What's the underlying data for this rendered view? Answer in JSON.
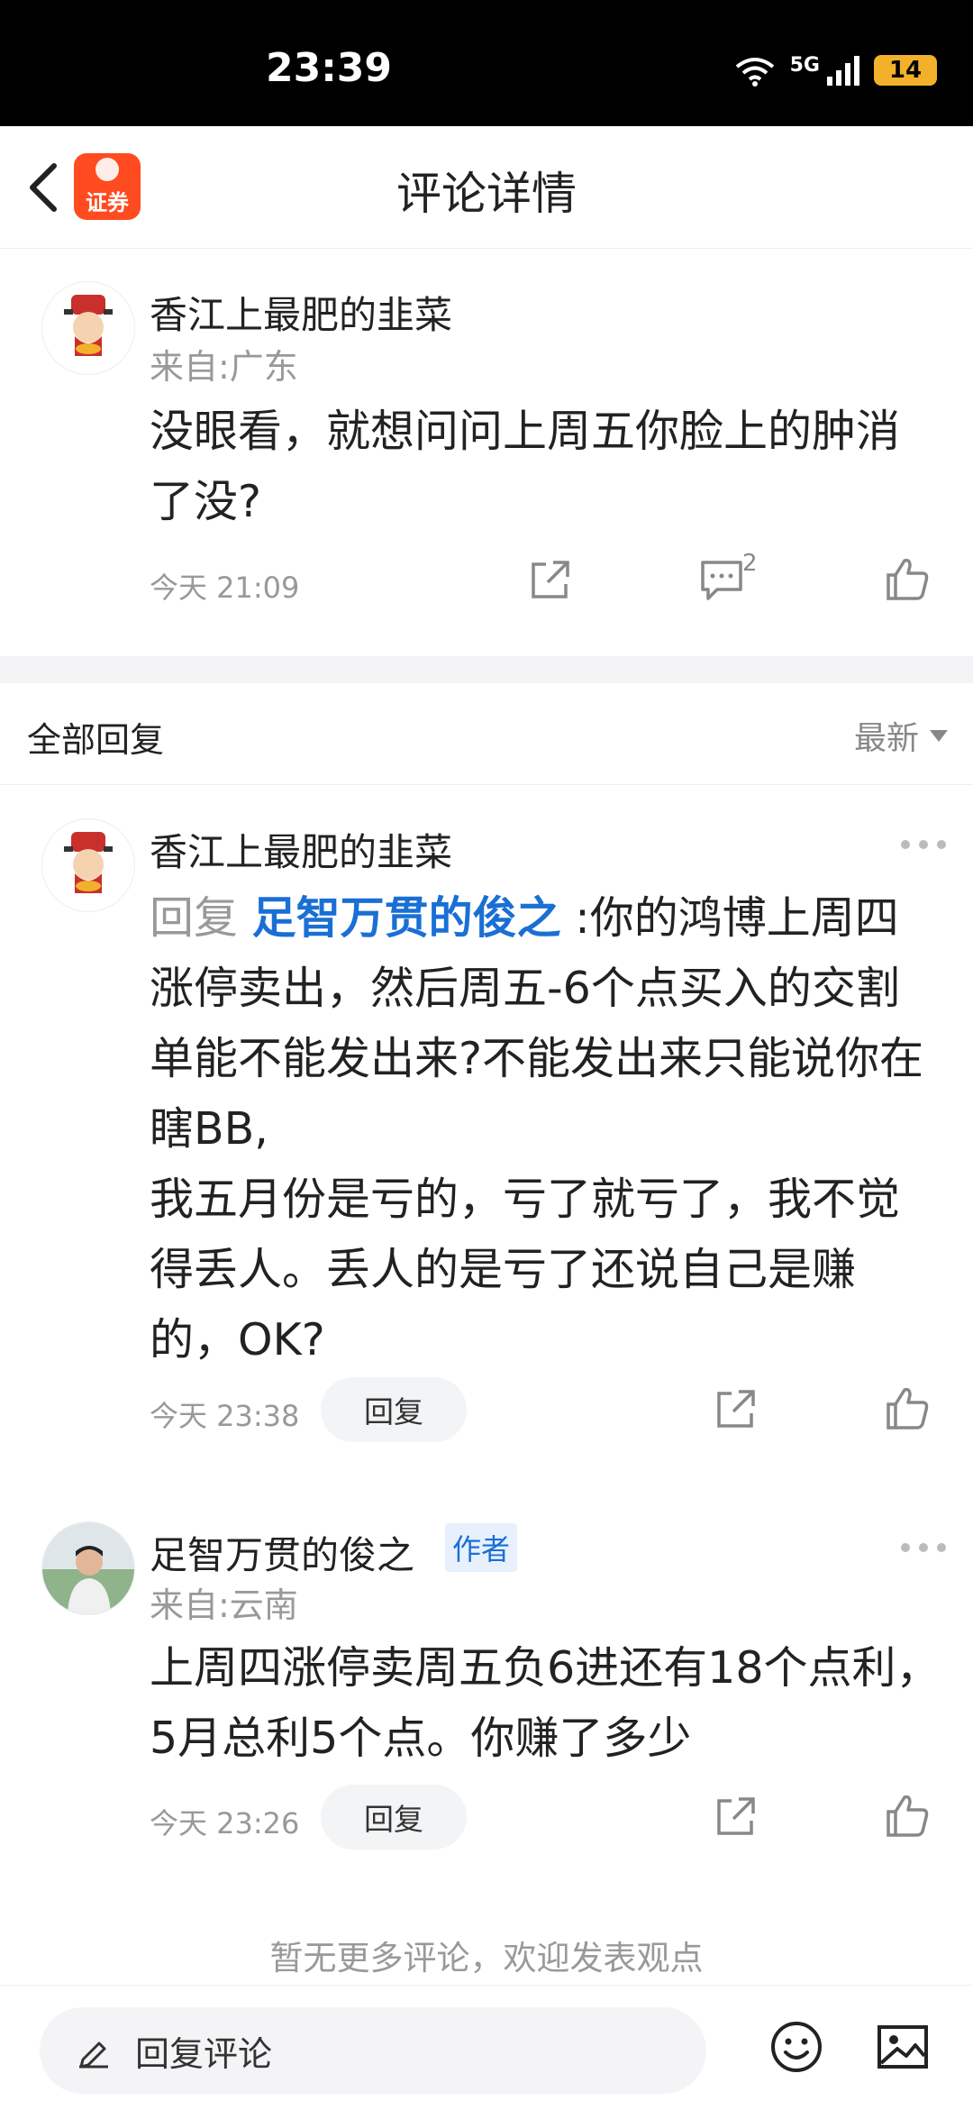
{
  "status_bar": {
    "time": "23:39",
    "network": "5G",
    "battery": "14"
  },
  "nav": {
    "title": "评论详情",
    "logo_text": "证券"
  },
  "main_comment": {
    "username": "香江上最肥的韭菜",
    "location": "来自:广东",
    "text": "没眼看，就想问问上周五你脸上的肿消了没?",
    "time": "今天 21:09",
    "comment_count": "2"
  },
  "replies_header": {
    "title": "全部回复",
    "sort": "最新"
  },
  "replies": [
    {
      "username": "香江上最肥的韭菜",
      "reply_prefix": "回复",
      "mention": "足智万贯的俊之",
      "text": ":你的鸿博上周四涨停卖出，然后周五-6个点买入的交割单能不能发出来?不能发出来只能说你在瞎BB,\n我五月份是亏的，亏了就亏了，我不觉得丢人。丢人的是亏了还说自己是赚的，OK?",
      "time": "今天 23:38",
      "reply_label": "回复"
    },
    {
      "username": "足智万贯的俊之",
      "tag": "作者",
      "location": "来自:云南",
      "text": "上周四涨停卖周五负6进还有18个点利，5月总利5个点。你赚了多少",
      "time": "今天 23:26",
      "reply_label": "回复"
    }
  ],
  "footer_note": "暂无更多评论，欢迎发表观点",
  "bottom_bar": {
    "placeholder": "回复评论"
  }
}
